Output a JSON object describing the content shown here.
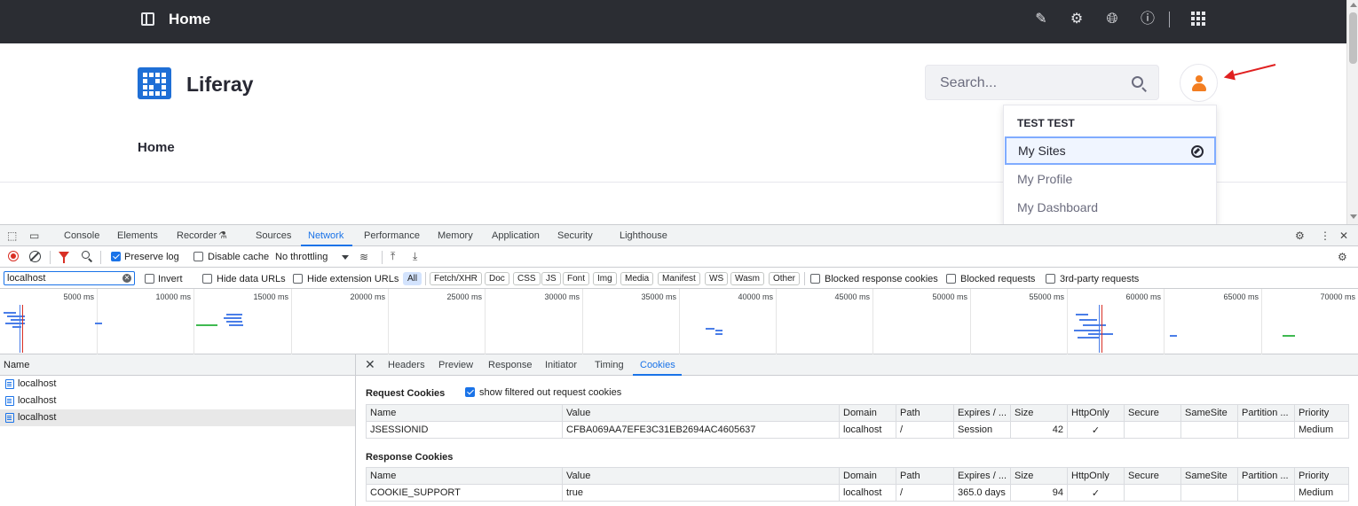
{
  "topbar": {
    "title": "Home"
  },
  "site": {
    "brand": "Liferay",
    "nav_home": "Home",
    "search_placeholder": "Search..."
  },
  "user_menu": {
    "header": "TEST TEST",
    "items": [
      "My Sites",
      "My Profile",
      "My Dashboard"
    ]
  },
  "devtools": {
    "tabs": [
      "Console",
      "Elements",
      "Recorder",
      "Sources",
      "Network",
      "Performance",
      "Memory",
      "Application",
      "Security",
      "Lighthouse"
    ],
    "active_tab": "Network",
    "toolbar": {
      "preserve_log": "Preserve log",
      "disable_cache": "Disable cache",
      "throttling": "No throttling"
    },
    "filter": {
      "value": "localhost",
      "invert": "Invert",
      "hide_data_urls": "Hide data URLs",
      "hide_extension_urls": "Hide extension URLs",
      "types": [
        "All",
        "Fetch/XHR",
        "Doc",
        "CSS",
        "JS",
        "Font",
        "Img",
        "Media",
        "Manifest",
        "WS",
        "Wasm",
        "Other"
      ],
      "blocked_response_cookies": "Blocked response cookies",
      "blocked_requests": "Blocked requests",
      "third_party": "3rd-party requests"
    },
    "timeline_ticks": [
      "5000 ms",
      "10000 ms",
      "15000 ms",
      "20000 ms",
      "25000 ms",
      "30000 ms",
      "35000 ms",
      "40000 ms",
      "45000 ms",
      "50000 ms",
      "55000 ms",
      "60000 ms",
      "65000 ms",
      "70000 ms"
    ],
    "requests": {
      "header": "Name",
      "rows": [
        "localhost",
        "localhost",
        "localhost"
      ]
    },
    "detail_tabs": [
      "Headers",
      "Preview",
      "Response",
      "Initiator",
      "Timing",
      "Cookies"
    ],
    "active_detail_tab": "Cookies",
    "request_cookies_title": "Request Cookies",
    "show_filtered": "show filtered out request cookies",
    "response_cookies_title": "Response Cookies",
    "columns": [
      "Name",
      "Value",
      "Domain",
      "Path",
      "Expires / ...",
      "Size",
      "HttpOnly",
      "Secure",
      "SameSite",
      "Partition ...",
      "Priority"
    ],
    "request_cookies": [
      {
        "name": "JSESSIONID",
        "value": "CFBA069AA7EFE3C31EB2694AC4605637",
        "domain": "localhost",
        "path": "/",
        "expires": "Session",
        "size": "42",
        "httponly": "✓",
        "secure": "",
        "samesite": "",
        "partition": "",
        "priority": "Medium"
      }
    ],
    "response_cookies": [
      {
        "name": "COOKIE_SUPPORT",
        "value": "true",
        "domain": "localhost",
        "path": "/",
        "expires": "365.0 days",
        "size": "94",
        "httponly": "✓",
        "secure": "",
        "samesite": "",
        "partition": "",
        "priority": "Medium"
      }
    ]
  },
  "colors": {
    "topbar": "#2b2d33",
    "accent": "#1a73e8",
    "liferay_blue": "#1f6fd6",
    "avatar": "#f37e21",
    "annotation": "#e02020"
  }
}
